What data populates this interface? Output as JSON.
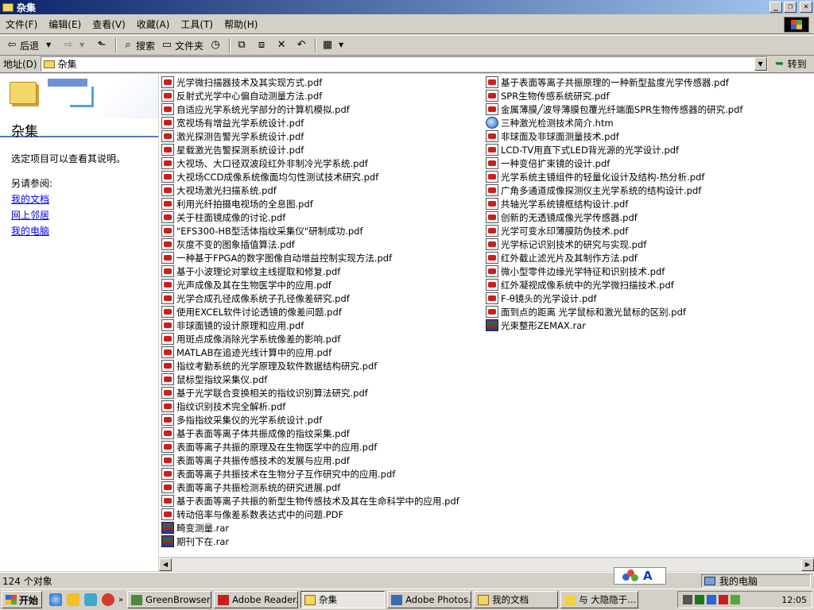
{
  "window": {
    "title": "杂集"
  },
  "menu": [
    "文件(F)",
    "编辑(E)",
    "查看(V)",
    "收藏(A)",
    "工具(T)",
    "帮助(H)"
  ],
  "toolbar": {
    "back": "后退",
    "search": "搜索",
    "folders": "文件夹"
  },
  "address": {
    "label": "地址(D)",
    "value": "杂集",
    "go": "转到"
  },
  "left_pane": {
    "title": "杂集",
    "hint": "选定项目可以查看其说明。",
    "see_also": "另请参阅:",
    "links": [
      "我的文档",
      "网上邻居",
      "我的电脑"
    ]
  },
  "files_col1": [
    {
      "name": "光学微扫描器技术及其实现方式.pdf",
      "type": "pdf"
    },
    {
      "name": "反射式光学中心偏自动测量方法.pdf",
      "type": "pdf"
    },
    {
      "name": "自适应光学系统光学部分的计算机模拟.pdf",
      "type": "pdf"
    },
    {
      "name": "宽视场有增益光学系统设计.pdf",
      "type": "pdf"
    },
    {
      "name": "激光探测告警光学系统设计.pdf",
      "type": "pdf"
    },
    {
      "name": "星载激光告警探测系统设计.pdf",
      "type": "pdf"
    },
    {
      "name": "大视场、大口径双波段红外非制冷光学系统.pdf",
      "type": "pdf"
    },
    {
      "name": "大视场CCD成像系统像面均匀性测试技术研究.pdf",
      "type": "pdf"
    },
    {
      "name": "大视场激光扫描系统.pdf",
      "type": "pdf"
    },
    {
      "name": "利用光纤拍摄电视场的全息图.pdf",
      "type": "pdf"
    },
    {
      "name": "关于柱面镜成像的讨论.pdf",
      "type": "pdf"
    },
    {
      "name": "\"EFS300-HB型活体指纹采集仪\"研制成功.pdf",
      "type": "pdf"
    },
    {
      "name": "灰度不变的图象插值算法.pdf",
      "type": "pdf"
    },
    {
      "name": "一种基于FPGA的数字图像自动增益控制实现方法.pdf",
      "type": "pdf"
    },
    {
      "name": "基于小波理论对掌纹主线提取和修复.pdf",
      "type": "pdf"
    },
    {
      "name": "光声成像及其在生物医学中的应用.pdf",
      "type": "pdf"
    },
    {
      "name": "光学合成孔径成像系统子孔径像差研究.pdf",
      "type": "pdf"
    },
    {
      "name": "使用EXCEL软件讨论透镜的像差问题.pdf",
      "type": "pdf"
    },
    {
      "name": "非球面镜的设计原理和应用.pdf",
      "type": "pdf"
    },
    {
      "name": "用斑点成像消除光学系统像差的影响.pdf",
      "type": "pdf"
    },
    {
      "name": "MATLAB在追迹光线计算中的应用.pdf",
      "type": "pdf"
    },
    {
      "name": "指纹考勤系统的光学原理及软件数据结构研究.pdf",
      "type": "pdf"
    },
    {
      "name": "鼠标型指纹采集仪.pdf",
      "type": "pdf"
    },
    {
      "name": "基于光学联合变换相关的指纹识别算法研究.pdf",
      "type": "pdf"
    },
    {
      "name": "指纹识别技术完全解析.pdf",
      "type": "pdf"
    },
    {
      "name": "多指指纹采集仪的光学系统设计.pdf",
      "type": "pdf"
    },
    {
      "name": "基于表面等离子体共振成像的指纹采集.pdf",
      "type": "pdf"
    },
    {
      "name": "表面等离子共振的原理及在生物医学中的应用.pdf",
      "type": "pdf"
    },
    {
      "name": "表面等离子共振传感技术的发展与应用.pdf",
      "type": "pdf"
    },
    {
      "name": "表面等离子共振技术在生物分子互作研究中的应用.pdf",
      "type": "pdf"
    },
    {
      "name": "表面等离子共振检测系统的研究进展.pdf",
      "type": "pdf"
    },
    {
      "name": "基于表面等离子共振的新型生物传感技术及其在生命科学中的应用.pdf",
      "type": "pdf"
    },
    {
      "name": "转动倍率与像差系数表达式中的问题.PDF",
      "type": "pdf"
    },
    {
      "name": "畸变测量.rar",
      "type": "rar"
    },
    {
      "name": "期刊下在.rar",
      "type": "rar"
    }
  ],
  "files_col2": [
    {
      "name": "基于表面等离子共振原理的一种新型盐度光学传感器.pdf",
      "type": "pdf"
    },
    {
      "name": "SPR生物传感系统研究.pdf",
      "type": "pdf"
    },
    {
      "name": "金属薄膜╱波导薄膜包覆光纤端面SPR生物传感器的研究.pdf",
      "type": "pdf"
    },
    {
      "name": "三种激光检测技术简介.htm",
      "type": "htm"
    },
    {
      "name": "非球面及非球面测量技术.pdf",
      "type": "pdf"
    },
    {
      "name": "LCD-TV用直下式LED背光源的光学设计.pdf",
      "type": "pdf"
    },
    {
      "name": "一种变倍扩束镜的设计.pdf",
      "type": "pdf"
    },
    {
      "name": "光学系统主镜组件的轻量化设计及结构-热分析.pdf",
      "type": "pdf"
    },
    {
      "name": "广角多通道成像探测仪主光学系统的结构设计.pdf",
      "type": "pdf"
    },
    {
      "name": "共轴光学系统镜框结构设计.pdf",
      "type": "pdf"
    },
    {
      "name": "创新的无透镜成像光学传感器.pdf",
      "type": "pdf"
    },
    {
      "name": "光学可变水印薄膜防伪技术.pdf",
      "type": "pdf"
    },
    {
      "name": "光学标记识别技术的研究与实现.pdf",
      "type": "pdf"
    },
    {
      "name": "红外截止滤光片及其制作方法.pdf",
      "type": "pdf"
    },
    {
      "name": "微小型零件边缘光学特征和识别技术.pdf",
      "type": "pdf"
    },
    {
      "name": "红外凝视成像系统中的光学微扫描技术.pdf",
      "type": "pdf"
    },
    {
      "name": "F-θ镜头的光学设计.pdf",
      "type": "pdf"
    },
    {
      "name": "面到点的距离 光学鼠标和激光鼠标的区别.pdf",
      "type": "pdf"
    },
    {
      "name": "光束整形ZEMAX.rar",
      "type": "rar"
    }
  ],
  "status": {
    "count": "124 个对象",
    "location": "我的电脑"
  },
  "taskbar": {
    "start": "开始",
    "tasks": [
      "GreenBrowser ...",
      "Adobe Reader...",
      "杂集",
      "Adobe Photos...",
      "我的文档",
      "与 大隐隐于..."
    ],
    "active_index": 2,
    "clock": "12:05"
  },
  "colors": {
    "title_start": "#0a246a",
    "title_end": "#a6caf0",
    "link": "#0000ee",
    "face": "#d4d0c8"
  }
}
